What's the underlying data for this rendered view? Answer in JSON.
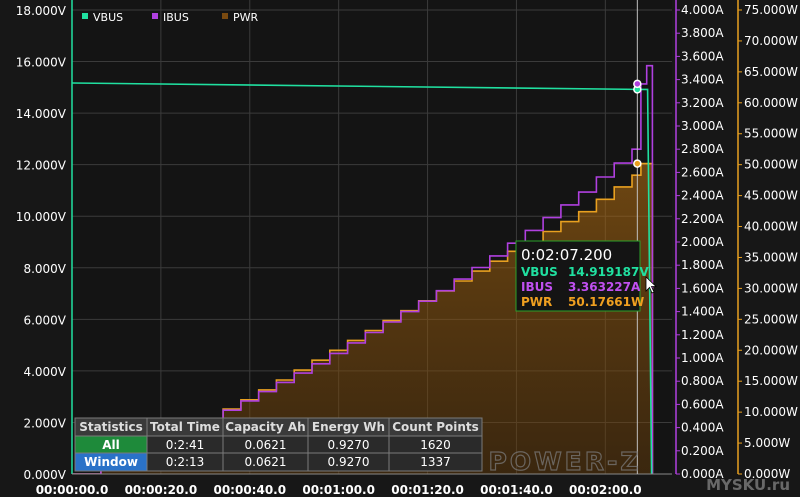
{
  "chart_data": {
    "type": "line",
    "title": "",
    "xlabel": "",
    "ylabel": "",
    "x_ticks": [
      "00:00:00.0",
      "00:00:20.0",
      "00:00:40.0",
      "00:01:00.0",
      "00:01:20.0",
      "00:01:40.0",
      "00:02:00.0"
    ],
    "x_tick_values": [
      0,
      20,
      40,
      60,
      80,
      100,
      120
    ],
    "xlim": [
      0,
      135
    ],
    "axes": {
      "left": {
        "ticks": [
          "0.000V",
          "2.000V",
          "4.000V",
          "6.000V",
          "8.000V",
          "10.000V",
          "12.000V",
          "14.000V",
          "16.000V",
          "18.000V"
        ],
        "ylim": [
          0,
          18
        ],
        "color": "#ffffff"
      },
      "right1": {
        "ticks": [
          "0.000A",
          "0.200A",
          "0.400A",
          "0.600A",
          "0.800A",
          "1.000A",
          "1.200A",
          "1.400A",
          "1.600A",
          "1.800A",
          "2.000A",
          "2.200A",
          "2.400A",
          "2.600A",
          "2.800A",
          "3.000A",
          "3.200A",
          "3.400A",
          "3.600A",
          "3.800A",
          "4.000A"
        ],
        "ylim": [
          0,
          4
        ],
        "color": "#b040e0"
      },
      "right2": {
        "ticks": [
          "0.000W",
          "5.000W",
          "10.000W",
          "15.000W",
          "20.000W",
          "25.000W",
          "30.000W",
          "35.000W",
          "40.000W",
          "45.000W",
          "50.000W",
          "55.000W",
          "60.000W",
          "65.000W",
          "70.000W",
          "75.000W"
        ],
        "ylim": [
          0,
          75
        ],
        "color": "#e8a020"
      }
    },
    "series": [
      {
        "name": "VBUS",
        "unit": "V",
        "axis": "left",
        "color": "#20e0a0",
        "x": [
          0,
          127.2,
          129.5,
          130.4
        ],
        "y": [
          15.17,
          14.919,
          14.92,
          0.0
        ]
      },
      {
        "name": "IBUS",
        "unit": "A",
        "axis": "right1",
        "color": "#b040e0",
        "step": true,
        "x": [
          0,
          2,
          6,
          6.5,
          10,
          14,
          18,
          22,
          26,
          30,
          34,
          38,
          42,
          46,
          50,
          54,
          58,
          62,
          66,
          70,
          74,
          78,
          82,
          86,
          90,
          94,
          98,
          102,
          106,
          110,
          114,
          118,
          122,
          126,
          128,
          129.3,
          130.3,
          130.6
        ],
        "y": [
          0.0,
          0.0,
          0.0,
          0.1,
          0.12,
          0.19,
          0.26,
          0.33,
          0.4,
          0.47,
          0.55,
          0.63,
          0.71,
          0.79,
          0.87,
          0.95,
          1.04,
          1.13,
          1.22,
          1.31,
          1.4,
          1.49,
          1.58,
          1.68,
          1.78,
          1.88,
          1.99,
          2.1,
          2.21,
          2.32,
          2.43,
          2.56,
          2.68,
          2.8,
          3.363,
          3.52,
          3.52,
          0.0
        ]
      },
      {
        "name": "PWR",
        "unit": "W",
        "axis": "right2",
        "color": "#e8a020",
        "fill": true,
        "step": true,
        "x": [
          0,
          2,
          6,
          6.5,
          10,
          14,
          18,
          22,
          26,
          30,
          34,
          38,
          42,
          46,
          50,
          54,
          58,
          62,
          66,
          70,
          74,
          78,
          82,
          86,
          90,
          94,
          98,
          102,
          106,
          110,
          114,
          118,
          122,
          126,
          128,
          129.3,
          130.3,
          130.6
        ],
        "y": [
          0.0,
          0.0,
          0.0,
          1.0,
          1.3,
          2.9,
          4.4,
          5.9,
          7.5,
          9.0,
          10.5,
          12.0,
          13.6,
          15.2,
          16.8,
          18.4,
          20.0,
          21.6,
          23.2,
          24.8,
          26.4,
          28.0,
          29.6,
          31.2,
          32.8,
          34.4,
          36.0,
          37.6,
          39.2,
          40.8,
          42.4,
          44.4,
          46.4,
          48.3,
          50.18,
          50.18,
          50.18,
          0.0
        ]
      }
    ],
    "legend": {
      "placement": "top-left",
      "entries": [
        "VBUS",
        "IBUS",
        "PWR"
      ]
    },
    "cursor": {
      "x": 127.2,
      "time": "0:02:07.200",
      "readouts": [
        {
          "label": "VBUS",
          "value": "14.919187V",
          "color": "#20e0a0"
        },
        {
          "label": "IBUS",
          "value": "3.363227A",
          "color": "#c050f0"
        },
        {
          "label": "PWR",
          "value": "50.17661W",
          "color": "#f0a020"
        }
      ]
    },
    "statistics_table": {
      "headers": [
        "Statistics",
        "Total Time",
        "Capacity Ah",
        "Energy Wh",
        "Count Points"
      ],
      "rows": [
        {
          "label": "All",
          "label_color": "#1e8a3a",
          "cells": [
            "0:2:41",
            "0.0621",
            "0.9270",
            "1620"
          ]
        },
        {
          "label": "Window",
          "label_color": "#2a72c8",
          "cells": [
            "0:2:13",
            "0.0621",
            "0.9270",
            "1337"
          ]
        }
      ]
    },
    "grid": true,
    "watermark": "POWER-Z",
    "site_watermark": "MYSKU.ru"
  }
}
